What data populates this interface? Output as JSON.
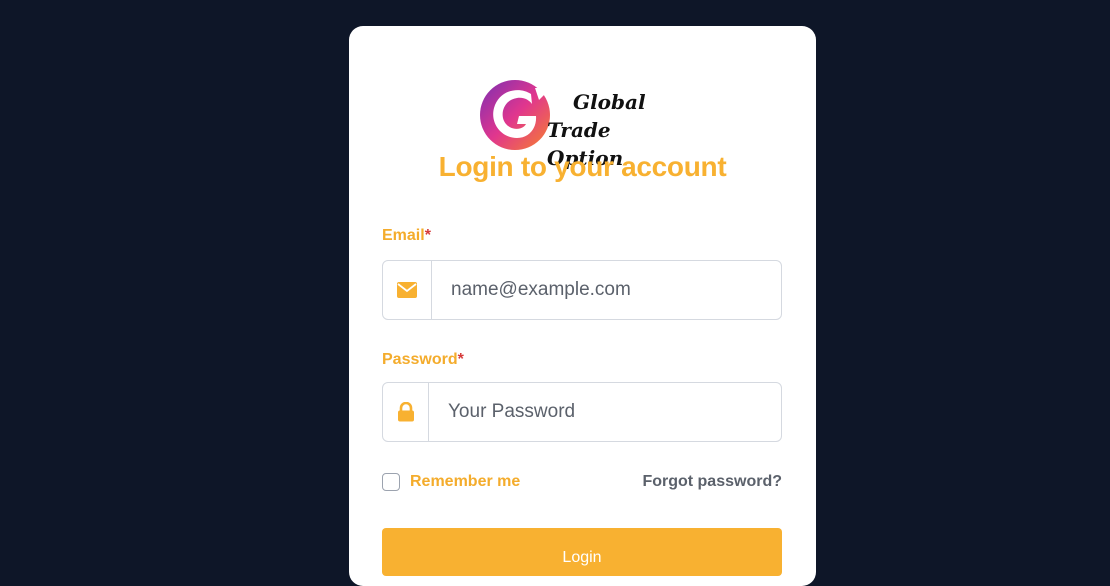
{
  "brand": {
    "line1": "Global",
    "line2": "Trade Option"
  },
  "title": "Login to your account",
  "email": {
    "label": "Email",
    "required_mark": "*",
    "placeholder": "name@example.com",
    "icon": "envelope-icon"
  },
  "password": {
    "label": "Password",
    "required_mark": "*",
    "placeholder": "Your Password",
    "icon": "lock-icon"
  },
  "remember": {
    "label": "Remember me",
    "checked": false
  },
  "forgot_label": "Forgot password?",
  "login_label": "Login",
  "colors": {
    "background": "#0e1628",
    "accent": "#f8b131",
    "required": "#d63b3b",
    "muted_text": "#5b616b"
  }
}
